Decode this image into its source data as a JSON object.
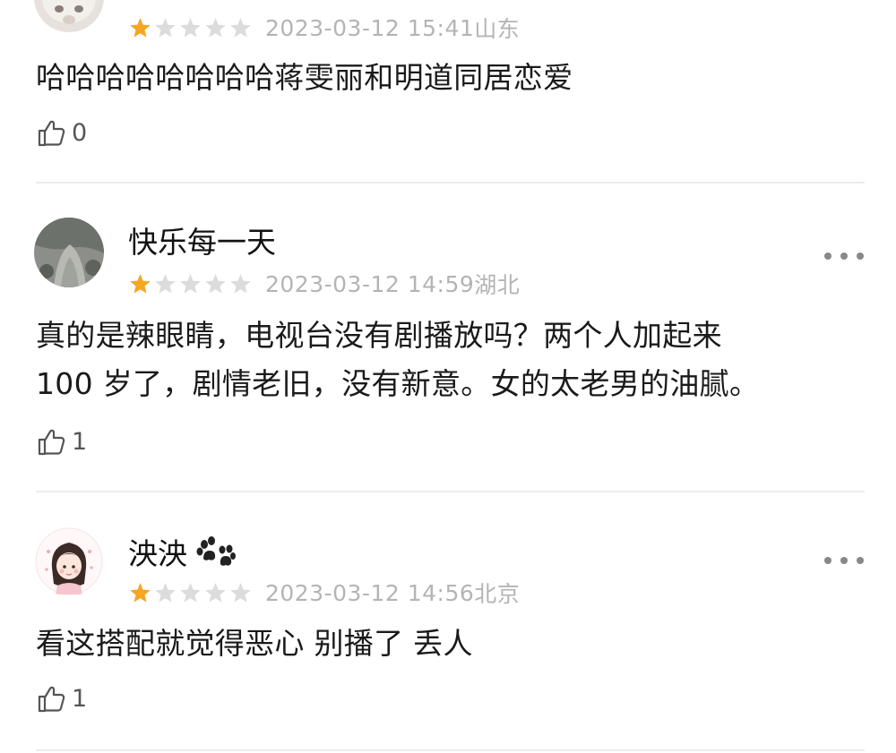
{
  "comments": [
    {
      "username": "",
      "rating": 1,
      "max_rating": 5,
      "date": "2023-03-12 15:41",
      "location": "山东",
      "text": "哈哈哈哈哈哈哈哈蒋雯丽和明道同居恋爱",
      "likes": "0"
    },
    {
      "username": "快乐每一天",
      "rating": 1,
      "max_rating": 5,
      "date": "2023-03-12 14:59",
      "location": "湖北",
      "text_line1": "真的是辣眼睛，电视台没有剧播放吗？两个人加起来",
      "text_line2": "100 岁了，剧情老旧，没有新意。女的太老男的油腻。",
      "likes": "1"
    },
    {
      "username": "泱泱",
      "rating": 1,
      "max_rating": 5,
      "date": "2023-03-12 14:56",
      "location": "北京",
      "text": "看这搭配就觉得恶心 别播了 丢人",
      "likes": "1"
    }
  ],
  "colors": {
    "star_filled": "#f5a623",
    "star_empty": "#dcdcdc",
    "meta_text": "#b4b4b4",
    "divider": "#ececec"
  },
  "icons": {
    "like": "thumbs-up-icon",
    "more": "more-dots-icon",
    "badge": "paw-icon"
  }
}
